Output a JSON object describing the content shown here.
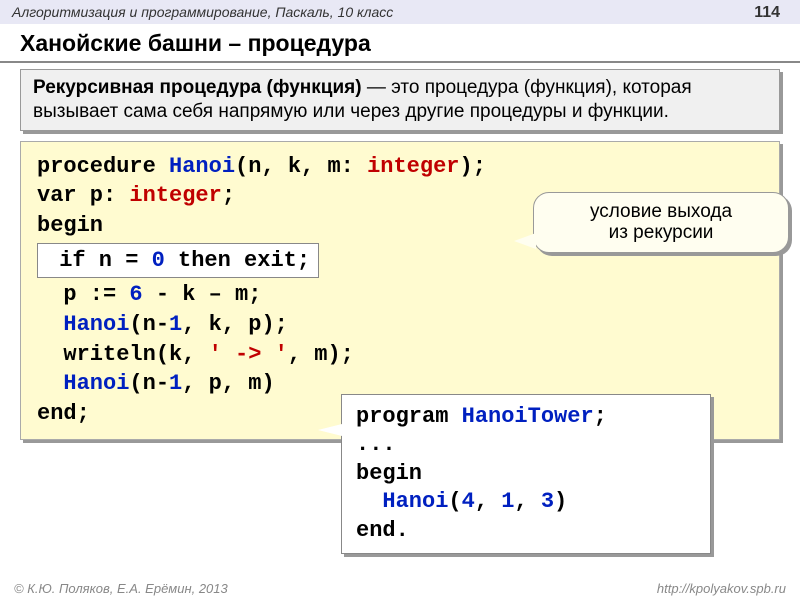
{
  "header": {
    "course": "Алгоритмизация и программирование, Паскаль, 10 класс",
    "page": "114"
  },
  "title": "Ханойские башни – процедура",
  "definition": {
    "bold": "Рекурсивная процедура (функция)",
    "rest": " — это процедура (функция), которая вызывает сама себя напрямую или через другие процедуры и функции."
  },
  "code": {
    "l1_kw1": "procedure ",
    "l1_fn": "Hanoi",
    "l1_p1": "(n, k, m: ",
    "l1_ty": "integer",
    "l1_p2": ");",
    "l2_kw": "var",
    "l2_rest": " p: ",
    "l2_ty": "integer",
    "l2_semi": ";",
    "l3": "begin",
    "l4_if": "if",
    "l4_mid": " n = ",
    "l4_zero": "0",
    "l4_then": " then exit;",
    "l5_a": "p := ",
    "l5_6": "6",
    "l5_b": " - k – m;",
    "l6_fn": "Hanoi",
    "l6_a": "(n-",
    "l6_1": "1",
    "l6_b": ", k, p);",
    "l7_a": "writeln(k, ",
    "l7_str": "' -> '",
    "l7_b": ", m);",
    "l8_fn": "Hanoi",
    "l8_a": "(n-",
    "l8_1": "1",
    "l8_b": ", p, m)",
    "l9": "end;"
  },
  "callout": {
    "l1": "условие выхода",
    "l2": "из рекурсии"
  },
  "program": {
    "l1_kw": "program ",
    "l1_fn": "HanoiTower",
    "l1_s": ";",
    "l2": "...",
    "l3": "begin",
    "l4_fn": "Hanoi",
    "l4_a": "(",
    "l4_n1": "4",
    "l4_c1": ", ",
    "l4_n2": "1",
    "l4_c2": ", ",
    "l4_n3": "3",
    "l4_b": ")",
    "l5": "end."
  },
  "footer": {
    "left": "© К.Ю. Поляков, Е.А. Ерёмин, 2013",
    "right": "http://kpolyakov.spb.ru"
  }
}
